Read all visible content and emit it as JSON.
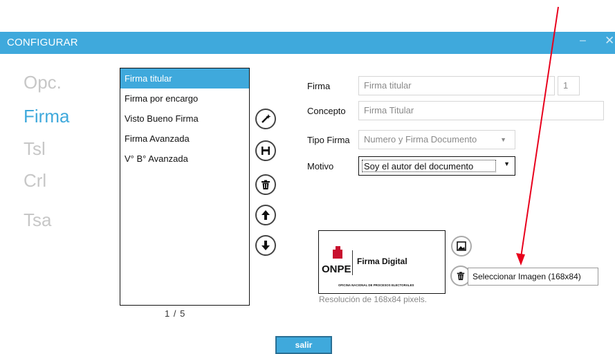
{
  "window": {
    "title": "CONFIGURAR",
    "minimize_glyph": "‒",
    "close_glyph": "✕"
  },
  "nav": [
    "Opc.",
    "Firma",
    "Tsl",
    "Crl",
    "Tsa"
  ],
  "list": {
    "items": [
      "Firma titular",
      "Firma por encargo",
      "Visto Bueno Firma",
      "Firma Avanzada",
      "V° B° Avanzada"
    ],
    "pager": "1  / 5"
  },
  "form": {
    "firma_label": "Firma",
    "firma_value": "Firma titular",
    "firma_number": "1",
    "concepto_label": "Concepto",
    "concepto_value": "Firma Titular",
    "tipo_label": "Tipo Firma",
    "tipo_value": "Numero y Firma Documento",
    "motivo_label": "Motivo",
    "motivo_value": "Soy el autor del documento"
  },
  "image": {
    "logo_org": "ONPE",
    "logo_caption": "Firma Digital",
    "logo_sub": "OFICINA NACIONAL DE PROCESOS ELECTORALES",
    "resolution": "Resolución de 168x84 pixels.",
    "tooltip": "Seleccionar Imagen (168x84)"
  },
  "footer": {
    "exit_label": "salir"
  },
  "colors": {
    "accent": "#3fa9dc",
    "annotation_arrow": "#e8001c"
  }
}
